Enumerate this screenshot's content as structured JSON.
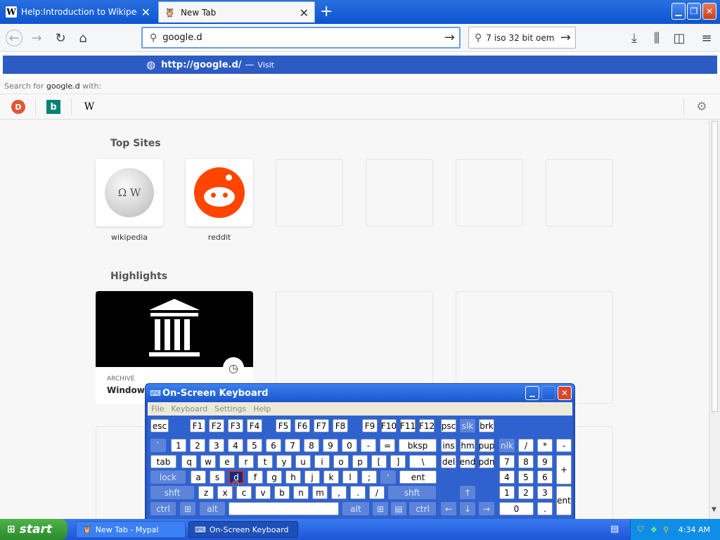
{
  "browser": {
    "tabs": [
      {
        "label": "Help:Introduction to Wikipedia - W"
      },
      {
        "label": "New Tab"
      }
    ],
    "url_value": "google.d",
    "search_value": "7 iso 32 bit oem",
    "suggestion": {
      "url": "http://google.d/",
      "sep": "—",
      "action": "Visit"
    },
    "search_with": {
      "prefix": "Search for",
      "term": "google.d",
      "suffix": "with:"
    }
  },
  "newtab": {
    "top_sites_title": "Top Sites",
    "top_sites": [
      {
        "label": "wikipedia"
      },
      {
        "label": "reddit"
      }
    ],
    "highlights_title": "Highlights",
    "highlight": {
      "kind": "ARCHIVE",
      "title": "Windows"
    }
  },
  "osk": {
    "title": "On-Screen Keyboard",
    "menu": [
      "File",
      "Keyboard",
      "Settings",
      "Help"
    ]
  },
  "taskbar": {
    "start": "start",
    "tasks": [
      "New Tab - Mypal",
      "On-Screen Keyboard"
    ],
    "clock": "4:34 AM"
  },
  "colors": {
    "titlebar": "#0b55d0",
    "suggest": "#2c5bc4",
    "reddit": "#ff4500"
  }
}
